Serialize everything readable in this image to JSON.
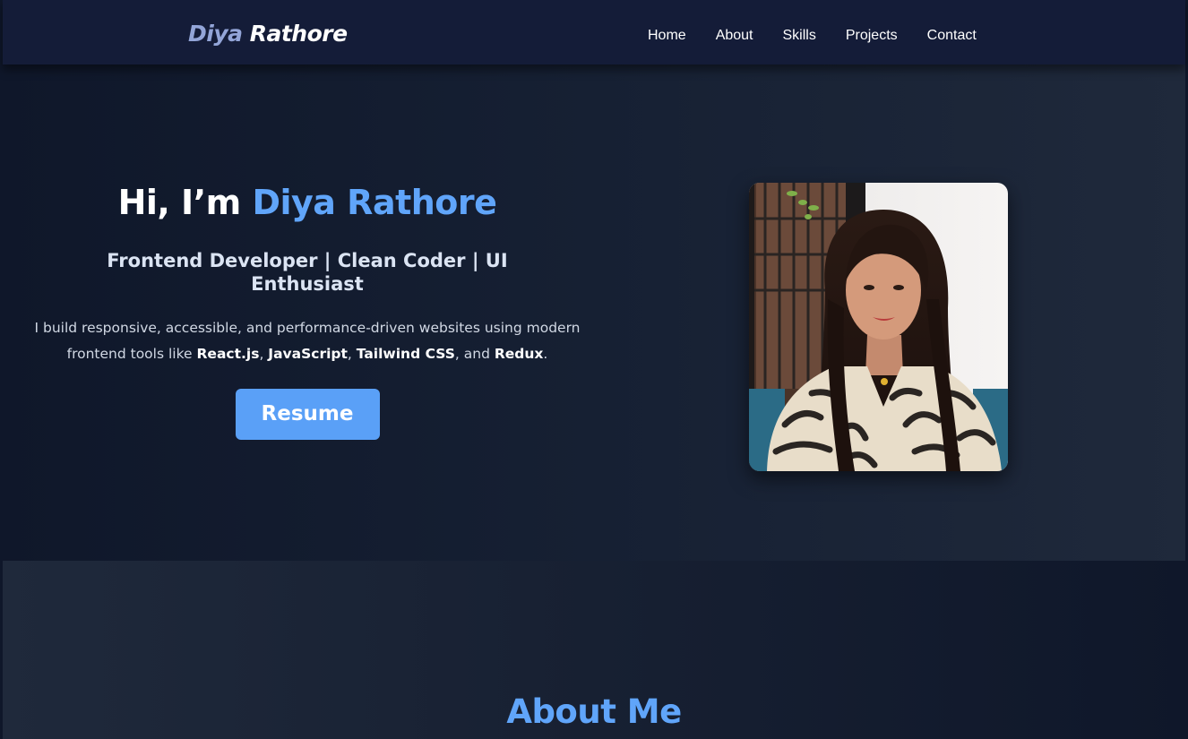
{
  "navbar": {
    "logo_first": "Diya",
    "logo_last": "Rathore",
    "links": [
      "Home",
      "About",
      "Skills",
      "Projects",
      "Contact"
    ]
  },
  "hero": {
    "greeting": "Hi, I’m",
    "name": "Diya Rathore",
    "subtitle": "Frontend Developer | Clean Coder | UI Enthusiast",
    "desc_part1": "I build responsive, accessible, and performance-driven websites using modern frontend tools like",
    "tool_1": "React.js",
    "tool_2": "JavaScript",
    "tool_3": "Tailwind CSS",
    "tool_4": "Redux",
    "resume_label": "Resume",
    "photo_alt": "profile-photo"
  },
  "about": {
    "title": "About Me"
  },
  "colors": {
    "accent": "#60a5fa",
    "button": "#5aa0f7",
    "navbar_bg": "#141c38",
    "page_bg": "#0f172a"
  }
}
